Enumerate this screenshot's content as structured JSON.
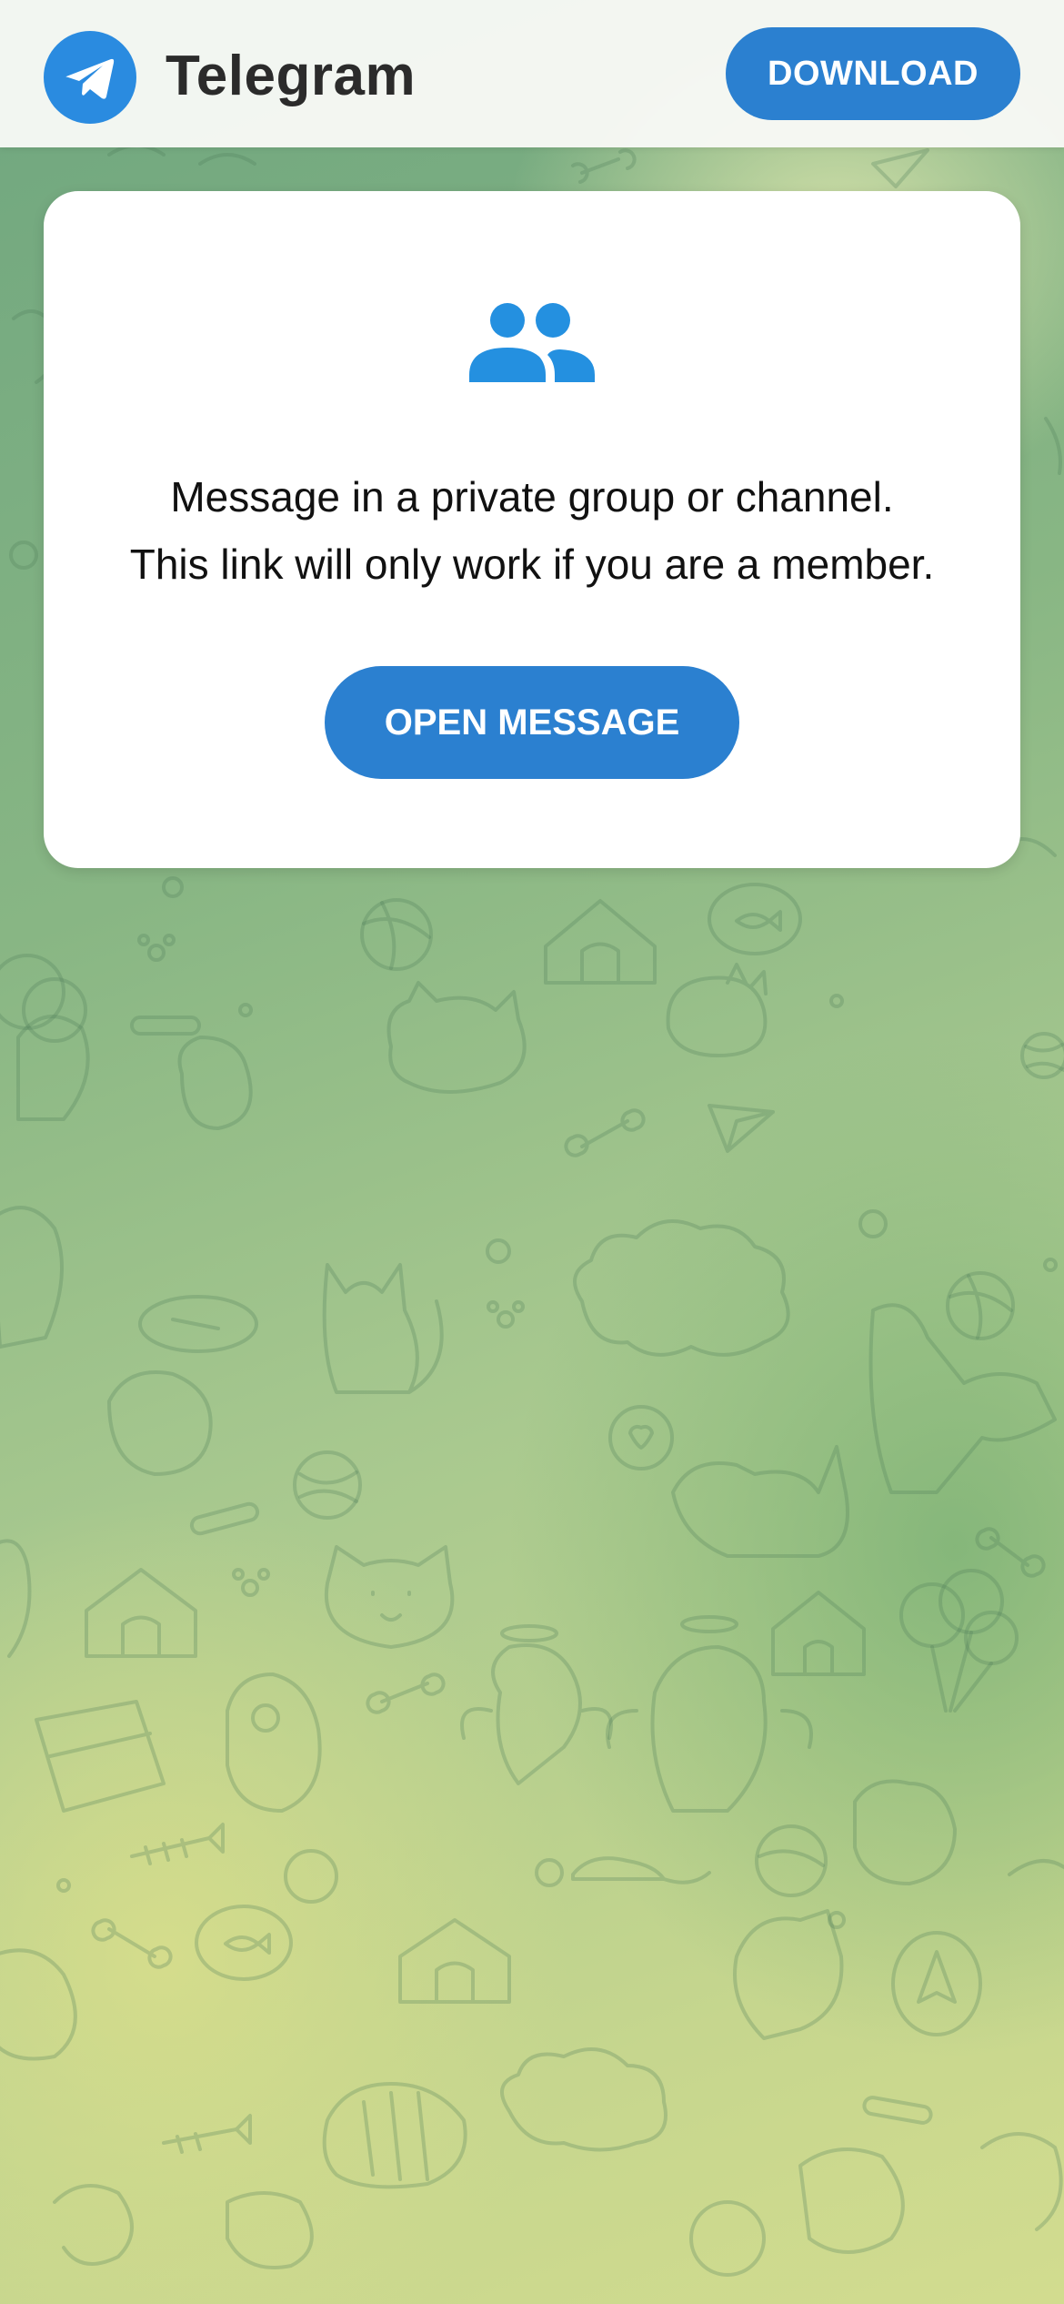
{
  "header": {
    "brand": "Telegram",
    "download_label": "DOWNLOAD"
  },
  "card": {
    "line1": "Message in a private group or channel.",
    "line2": "This link will only work if you are a member.",
    "open_label": "OPEN MESSAGE"
  },
  "icons": {
    "logo": "telegram-paper-plane-icon",
    "group": "group-people-icon"
  },
  "colors": {
    "accent": "#2b80d0",
    "logo_blue": "#2a8be0",
    "group_icon": "#2490e0",
    "background_green": "#88b684",
    "background_yellow": "#d2dc8f",
    "header_bg": "#f8f9f6",
    "card_bg": "#ffffff",
    "text": "#111111"
  }
}
